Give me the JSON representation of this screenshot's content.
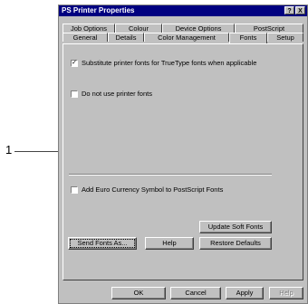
{
  "callout": {
    "number": "1"
  },
  "window": {
    "title": "PS Printer Properties",
    "help_btn": "?",
    "close_btn": "X"
  },
  "tabs_row1": [
    "Job Options",
    "Colour",
    "Device Options",
    "PostScript"
  ],
  "tabs_row2": [
    "General",
    "Details",
    "Color Management",
    "Fonts",
    "Setup"
  ],
  "active_tab": "Fonts",
  "options": {
    "substitute": {
      "label": "Substitute printer fonts for TrueType fonts when applicable",
      "checked": true
    },
    "do_not_use": {
      "label": "Do not use printer fonts",
      "checked": false
    },
    "euro": {
      "label": "Add Euro Currency Symbol to PostScript Fonts",
      "checked": false
    }
  },
  "buttons": {
    "update_soft_fonts": "Update Soft Fonts",
    "send_fonts_as": "Send Fonts As...",
    "help": "Help",
    "restore_defaults": "Restore Defaults"
  },
  "footer": {
    "ok": "OK",
    "cancel": "Cancel",
    "apply": "Apply",
    "help": "Help"
  }
}
